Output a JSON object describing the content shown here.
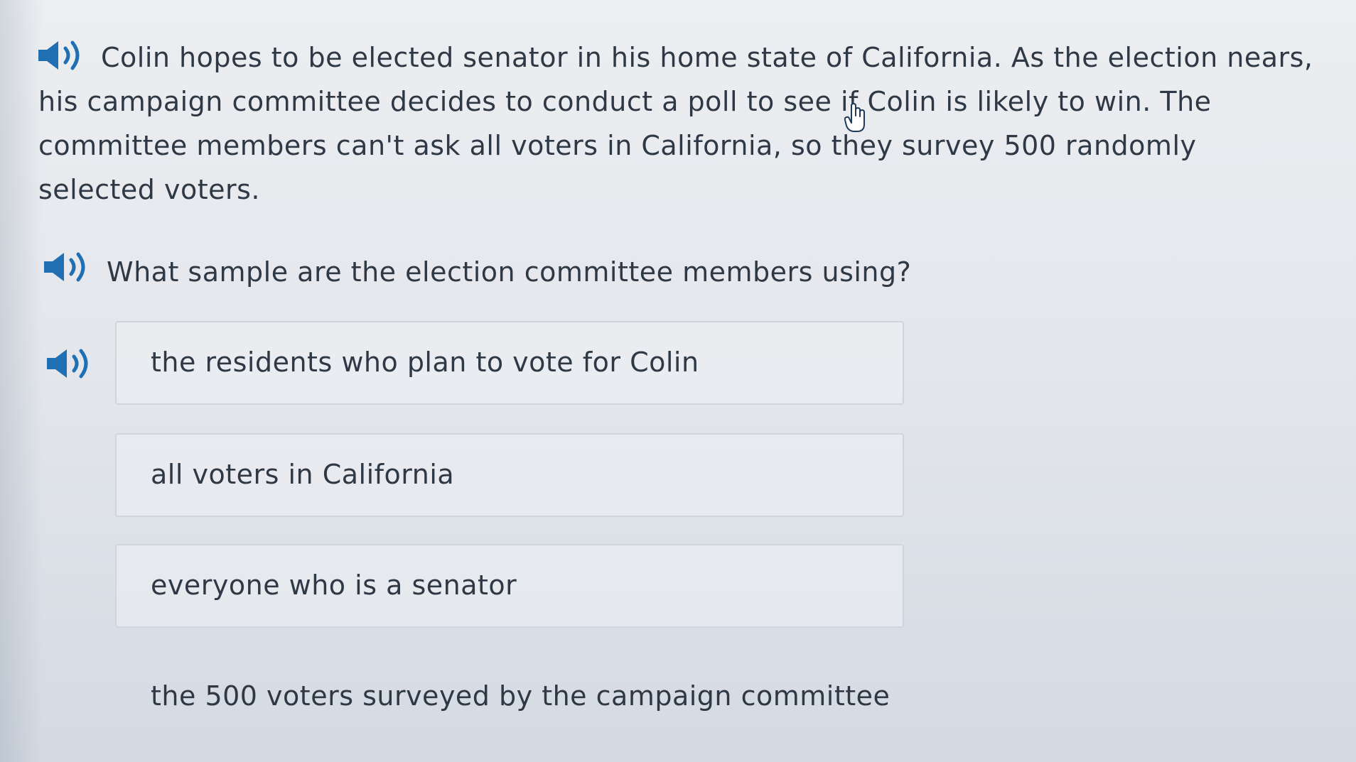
{
  "passage": {
    "text": "Colin hopes to be elected senator in his home state of California. As the election nears, his campaign committee decides to conduct a poll to see if Colin is likely to win. The committee members can't ask all voters in California, so they survey 500 randomly selected voters."
  },
  "question": {
    "text": "What sample are the election committee members using?"
  },
  "options": [
    {
      "label": "the residents who plan to vote for Colin"
    },
    {
      "label": "all voters in California"
    },
    {
      "label": "everyone who is a senator"
    },
    {
      "label": "the 500 voters surveyed by the campaign committee"
    }
  ],
  "icons": {
    "speaker": "speaker-icon",
    "cursor": "hand-cursor-icon",
    "accent_color": "#1f6fb2"
  }
}
